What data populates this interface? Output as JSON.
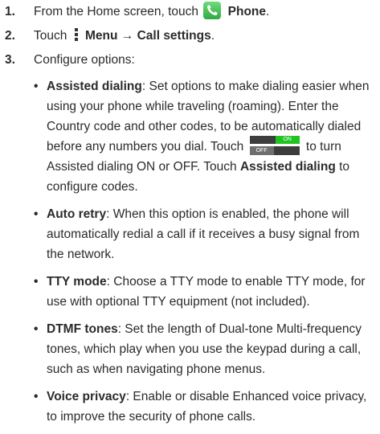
{
  "steps": [
    {
      "num": "1.",
      "pre": "From the Home screen, touch",
      "bold": "Phone",
      "post": "."
    },
    {
      "num": "2.",
      "pre": "Touch",
      "bold": "Menu → Call settings",
      "post": "."
    },
    {
      "num": "3.",
      "text": "Configure options:"
    }
  ],
  "options": [
    {
      "title": "Assisted dialing",
      "body_a": ": Set options to make dialing easier when using your phone while traveling (roaming). Enter the Country code and other codes, to be automatically dialed before any numbers you dial. Touch",
      "body_b": "to turn Assisted dialing ON or OFF. Touch",
      "body_c_bold": "Assisted dialing",
      "body_d": "to configure codes."
    },
    {
      "title": "Auto retry",
      "body": ": When this option is enabled, the phone will automatically redial a call if it receives a busy signal from the network."
    },
    {
      "title": "TTY mode",
      "body": ": Choose a TTY mode to enable TTY mode, for use with optional TTY equipment (not included)."
    },
    {
      "title": "DTMF tones",
      "body": ": Set the length of Dual-tone Multi-frequency tones, which play when you use the keypad during a call, such as when navigating phone menus."
    },
    {
      "title": "Voice privacy",
      "body": ": Enable or disable Enhanced voice privacy, to improve the security of phone calls."
    }
  ],
  "toggle": {
    "on_label": "ON",
    "off_label": "OFF",
    "on_color": "#21c321",
    "off_color": "#6f6f6f"
  },
  "icons": {
    "phone": "phone-app-icon",
    "menu": "menu-icon",
    "toggle": "on-off-toggle-icon"
  }
}
